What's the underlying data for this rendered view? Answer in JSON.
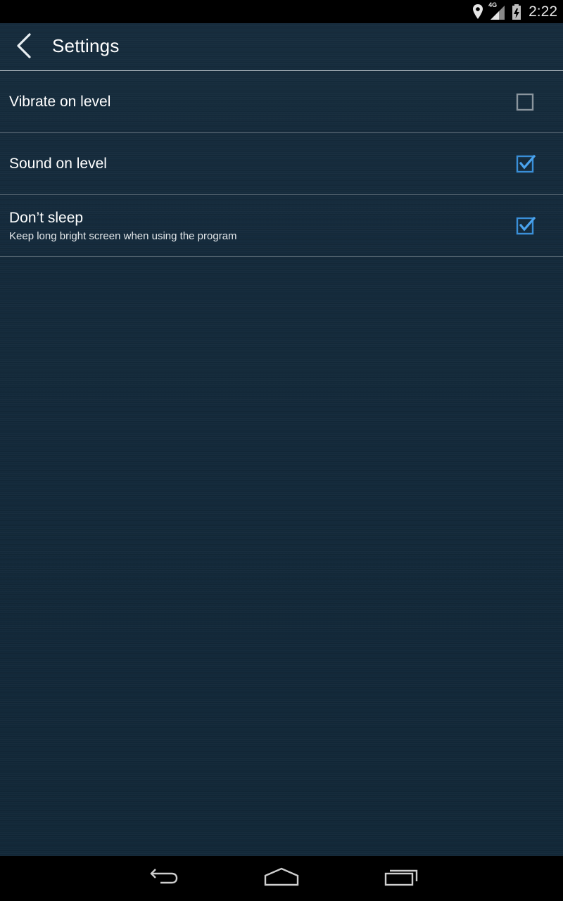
{
  "status_bar": {
    "time": "2:22",
    "network_label": "4G",
    "icons": [
      "location-icon",
      "signal-icon",
      "battery-icon"
    ]
  },
  "action_bar": {
    "title": "Settings",
    "back_icon": "chevron-left-icon"
  },
  "preferences": [
    {
      "title": "Vibrate on level",
      "summary": "",
      "checked": false
    },
    {
      "title": "Sound on level",
      "summary": "",
      "checked": true
    },
    {
      "title": "Don’t sleep",
      "summary": "Keep long bright screen when using the program",
      "checked": true
    }
  ],
  "nav_bar": {
    "icons": [
      "back-icon",
      "home-icon",
      "recents-icon"
    ]
  },
  "colors": {
    "background": "#142a3a",
    "accent": "#33b5e5",
    "checkbox_unchecked": "#8a959d"
  }
}
